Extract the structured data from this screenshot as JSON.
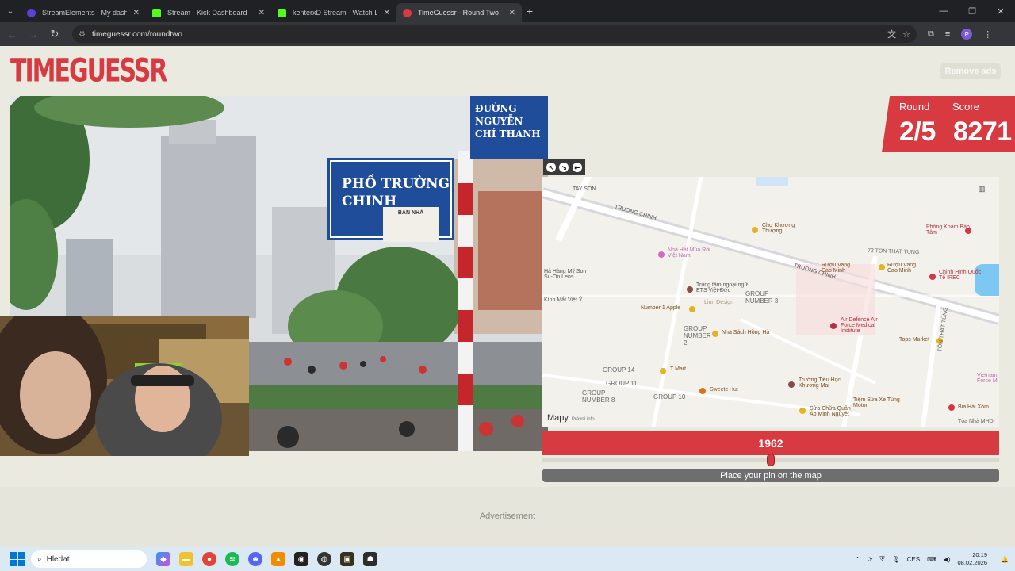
{
  "browser": {
    "tabs": [
      {
        "title": "StreamElements - My dashboard",
        "color": "#5b3fd6"
      },
      {
        "title": "Stream - Kick Dashboard",
        "color": "#53fc18"
      },
      {
        "title": "kenterxD Stream - Watch Live o",
        "color": "#53fc18"
      },
      {
        "title": "TimeGuessr - Round Two",
        "color": "#d83a42"
      }
    ],
    "url": "timeguessr.com/roundtwo",
    "profile_initial": "P"
  },
  "page": {
    "logo": "TIMEGUESSR",
    "remove_ads": "Remove ads",
    "round_label": "Round",
    "round_value": "2/5",
    "score_label": "Score",
    "score_value": "8271",
    "year": "1962",
    "year_fraction": 0.5,
    "place_pin": "Place your pin on the map",
    "advertisement": "Advertisement"
  },
  "photo": {
    "sign_top": "ĐƯỜNG NGUYỄN CHÍ THANH",
    "sign_main": "PHỐ TRƯỜNG CHINH",
    "sign_small": "BÁN NHÀ"
  },
  "map": {
    "labels": [
      "TAY SON",
      "TRUONG CHINH",
      "Chợ Khương Thượng",
      "Phòng Khám Bảo Tâm",
      "72 TON THAT TUNG",
      "Nhà Hát Múa Rối Việt Nam",
      "Rượu Vang Cao Minh",
      "Rượu Vang Cao Minh",
      "Chinh Hinh Quốc Tế IREC",
      "TRUONG CHINH",
      "Hà Hàng Mỹ Son Su-On Lens",
      "Trung tâm ngoại ngữ ETS Việt-Đức",
      "GROUP NUMBER 3",
      "Kính Mắt Việt Ý",
      "Number 1 Apple",
      "Linn Design",
      "Air Defence Air Force Medical Institute",
      "GROUP NUMBER 2",
      "Nhà Sách Hồng Hà",
      "Tops Market",
      "GROUP 14",
      "T Mart",
      "GROUP 11",
      "GROUP NUMBER 8",
      "GROUP 10",
      "Sweetc Hut",
      "Trường Tiểu Học Khương Mai",
      "Tiệm Sửa Xe Tùng Motor",
      "Bia Hải Xồm",
      "Sửa Chữa Quần Áo Minh Nguyệt",
      "TÔN THẤT TÙNG",
      "Tòa Nhà MHDI",
      "Vietnam Force M"
    ],
    "attribution": "Mapy",
    "legal": "Právní info"
  },
  "taskbar": {
    "search_placeholder": "Hledat",
    "lang": "CES",
    "time": "20:19",
    "date": "08.02.2026"
  }
}
